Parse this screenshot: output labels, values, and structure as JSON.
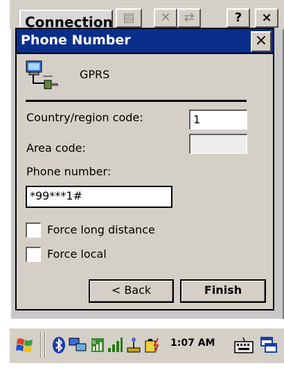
{
  "background_window": {
    "title": "Connection",
    "toolbar_help": "?",
    "toolbar_close": "×"
  },
  "dialog": {
    "title": "Phone Number",
    "close_label": "×",
    "connection_name": "GPRS",
    "country_code_label": "Country/region code:",
    "country_code_value": "1",
    "area_code_label": "Area code:",
    "area_code_value": "",
    "phone_number_label": "Phone number:",
    "phone_number_value": "*99***1#",
    "force_long_distance_label": "Force long distance",
    "force_local_label": "Force local",
    "back_button_label": "< Back",
    "finish_button_label": "Finish"
  },
  "taskbar": {
    "clock": "1:07 AM",
    "icons": [
      "start-icon",
      "bluetooth-icon",
      "network-icon",
      "signal-icon",
      "usb-icon",
      "battery-icon",
      "keyboard-icon",
      "windows-switch-icon"
    ]
  },
  "colors": {
    "dialog_title_bar": "#0a2e8c",
    "dialog_face": "#d4d0c8",
    "field_background": "#ffffff"
  }
}
